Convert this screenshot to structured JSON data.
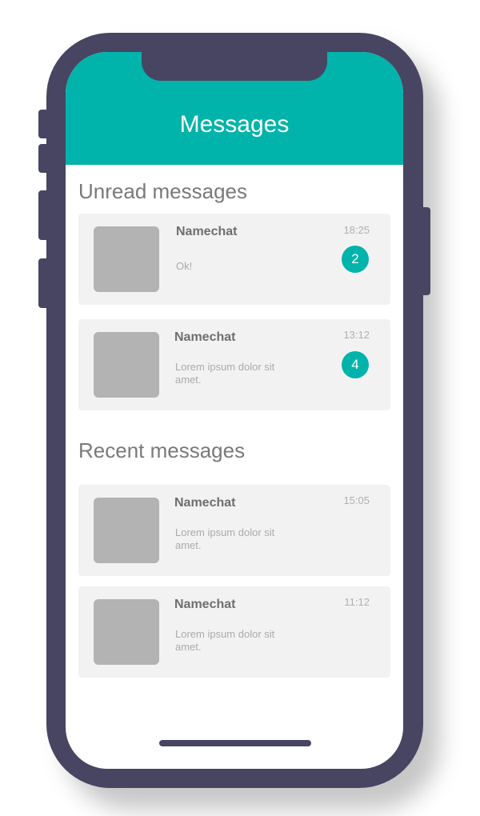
{
  "header": {
    "title": "Messages"
  },
  "sections": {
    "unread": {
      "title": "Unread messages",
      "items": [
        {
          "name": "Namechat",
          "preview": "Ok!",
          "time": "18:25",
          "badge": "2"
        },
        {
          "name": "Namechat",
          "preview": "Lorem ipsum dolor sit amet.",
          "time": "13:12",
          "badge": "4"
        }
      ]
    },
    "recent": {
      "title": "Recent messages",
      "items": [
        {
          "name": "Namechat",
          "preview": "Lorem ipsum dolor sit amet.",
          "time": "15:05"
        },
        {
          "name": "Namechat",
          "preview": "Lorem ipsum dolor sit amet.",
          "time": "11:12"
        }
      ]
    }
  },
  "colors": {
    "accent": "#00b3ab",
    "device": "#474562",
    "card": "#f2f2f2",
    "avatar": "#b3b3b3"
  }
}
